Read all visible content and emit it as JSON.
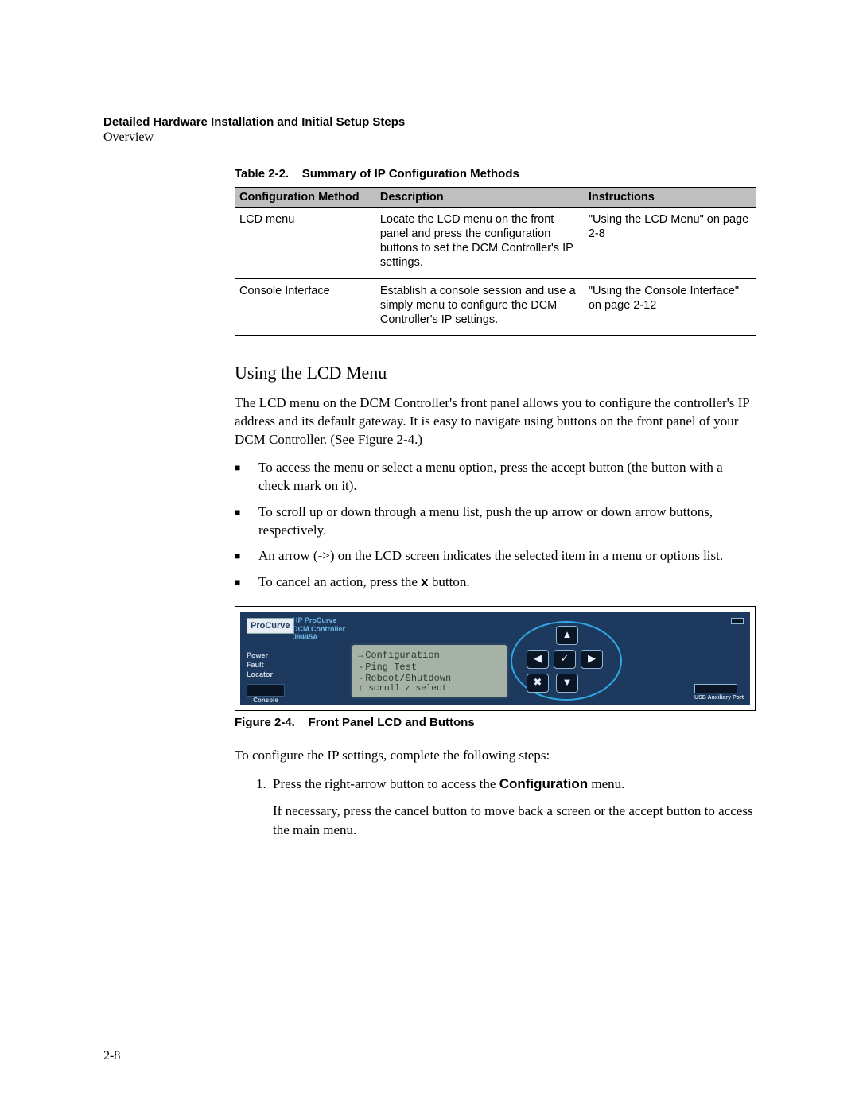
{
  "header": {
    "title": "Detailed Hardware Installation and Initial Setup Steps",
    "subtitle": "Overview"
  },
  "table": {
    "caption_no": "Table 2-2.",
    "caption_title": "Summary of IP Configuration Methods",
    "headers": [
      "Configuration Method",
      "Description",
      "Instructions"
    ],
    "rows": [
      {
        "method": "LCD menu",
        "desc": "Locate the LCD menu on the front panel and press the configuration buttons to set the DCM Controller's IP settings.",
        "instr": "\"Using the LCD Menu\" on page 2-8"
      },
      {
        "method": "Console Interface",
        "desc": "Establish a console session and use a simply menu to configure the DCM Controller's IP settings.",
        "instr": "\"Using the Console Interface\" on page 2-12"
      }
    ]
  },
  "section": {
    "heading": "Using the LCD Menu",
    "intro": "The LCD menu on the DCM Controller's front panel allows you to configure the controller's IP address and its default gateway. It is easy to navigate using buttons on the front panel of your DCM Controller. (See Figure 2-4.)",
    "bullets": [
      "To access the menu or select a menu option, press the accept button (the button with a check mark on it).",
      "To scroll up or down through a menu list, push the up arrow or down arrow buttons, respectively.",
      "An arrow (->) on the LCD screen indicates the selected item in a menu or options list.",
      "To cancel an action, press the x button."
    ],
    "x_bold": "x"
  },
  "figure": {
    "logo": "ProCurve",
    "model_line1": "HP ProCurve",
    "model_line2": "DCM Controller",
    "model_line3": "J9445A",
    "leds": [
      "Power",
      "Fault",
      "Locator"
    ],
    "console_label": "Console",
    "lcd_lines": {
      "sel": "Configuration",
      "opt1": "Ping Test",
      "opt2": "Reboot/Shutdown",
      "hint": "↕ scroll ✓ select"
    },
    "buttons": {
      "up": "▲",
      "down": "▼",
      "left": "◀",
      "right": "▶",
      "ok": "✓",
      "x": "✖"
    },
    "usb_label": "USB Auxiliary Port",
    "caption_no": "Figure 2-4.",
    "caption_title": "Front Panel LCD and Buttons"
  },
  "steps": {
    "intro": "To configure the IP settings, complete the following steps:",
    "items": [
      {
        "pre": "Press the right-arrow button to access the ",
        "bold": "Configuration",
        "post": " menu.",
        "para": "If necessary, press the cancel button to move back a screen or the accept button to access the main menu."
      }
    ]
  },
  "page_number": "2-8"
}
